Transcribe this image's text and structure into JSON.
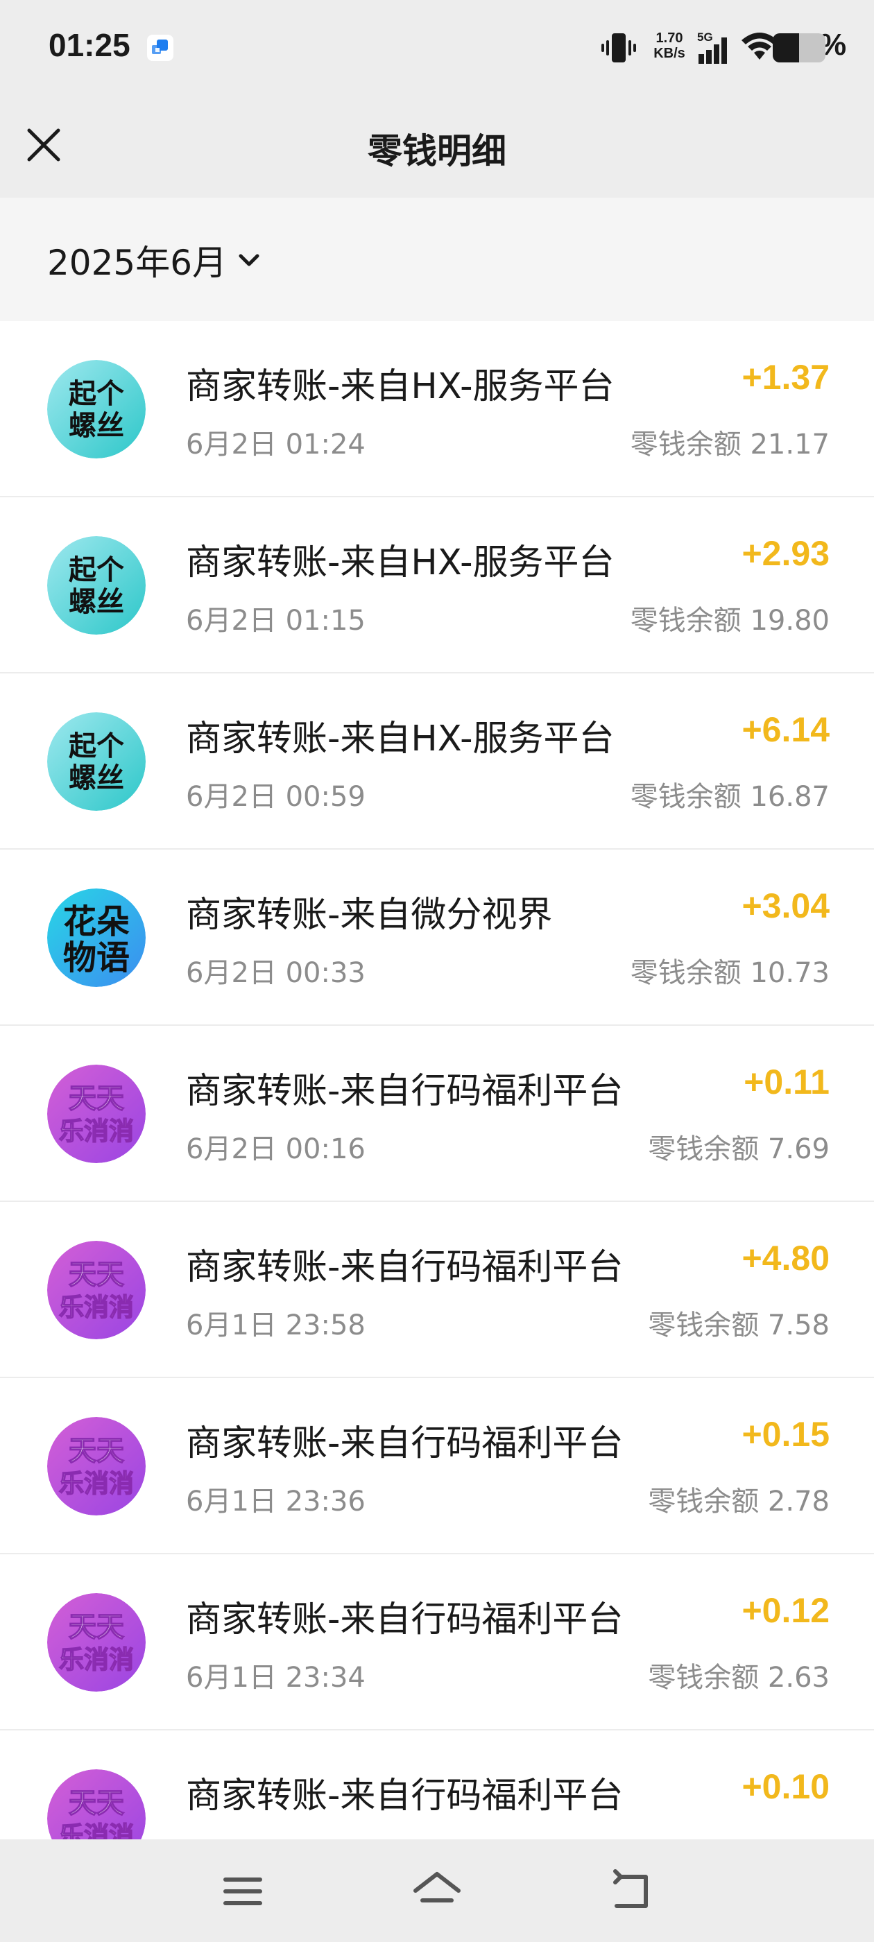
{
  "status_bar": {
    "time": "01:25",
    "net_speed_value": "1.70",
    "net_speed_unit": "KB/s",
    "network_type": "5G",
    "battery_percent": "50%",
    "battery_level": 0.5,
    "icons": [
      "app-notification-icon",
      "vibrate-icon",
      "signal-icon",
      "wifi-icon",
      "battery-icon"
    ]
  },
  "header": {
    "title": "零钱明细",
    "close_icon": "close-icon"
  },
  "filter": {
    "month_label": "2025年6月",
    "dropdown_icon": "chevron-down-icon"
  },
  "avatars": {
    "qigeluosi": {
      "line1": "起个",
      "line2": "螺丝",
      "colors": [
        "#9ee8ee",
        "#2dc7c9"
      ]
    },
    "huaduowuyu": {
      "line1": "花朵",
      "line2": "物语",
      "colors": [
        "#29d6e6",
        "#3b8df0"
      ]
    },
    "tiantian": {
      "line1": "天天",
      "line2": "乐消消",
      "colors": [
        "#d35fd6",
        "#9a45e3"
      ]
    }
  },
  "transactions": [
    {
      "avatar": "qigeluosi",
      "title": "商家转账-来自HX-服务平台",
      "time": "6月2日 01:24",
      "amount": "+1.37",
      "balance": "零钱余额 21.17"
    },
    {
      "avatar": "qigeluosi",
      "title": "商家转账-来自HX-服务平台",
      "time": "6月2日 01:15",
      "amount": "+2.93",
      "balance": "零钱余额 19.80"
    },
    {
      "avatar": "qigeluosi",
      "title": "商家转账-来自HX-服务平台",
      "time": "6月2日 00:59",
      "amount": "+6.14",
      "balance": "零钱余额 16.87"
    },
    {
      "avatar": "huaduowuyu",
      "title": "商家转账-来自微分视界",
      "time": "6月2日 00:33",
      "amount": "+3.04",
      "balance": "零钱余额 10.73"
    },
    {
      "avatar": "tiantian",
      "title": "商家转账-来自行码福利平台",
      "time": "6月2日 00:16",
      "amount": "+0.11",
      "balance": "零钱余额 7.69"
    },
    {
      "avatar": "tiantian",
      "title": "商家转账-来自行码福利平台",
      "time": "6月1日 23:58",
      "amount": "+4.80",
      "balance": "零钱余额 7.58"
    },
    {
      "avatar": "tiantian",
      "title": "商家转账-来自行码福利平台",
      "time": "6月1日 23:36",
      "amount": "+0.15",
      "balance": "零钱余额 2.78"
    },
    {
      "avatar": "tiantian",
      "title": "商家转账-来自行码福利平台",
      "time": "6月1日 23:34",
      "amount": "+0.12",
      "balance": "零钱余额 2.63"
    },
    {
      "avatar": "tiantian",
      "title": "商家转账-来自行码福利平台",
      "time": "",
      "amount": "+0.10",
      "balance": ""
    }
  ],
  "nav_bar": {
    "icons": [
      "menu-icon",
      "home-icon",
      "back-icon"
    ]
  },
  "colors": {
    "amount": "#f2b81c",
    "secondary_text": "#8c8c8c",
    "header_bg": "#ededed",
    "filter_bg": "#f5f5f5"
  }
}
